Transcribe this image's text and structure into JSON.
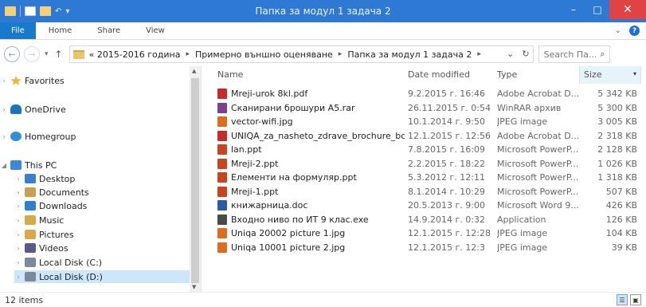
{
  "window": {
    "title": "Папка за модул 1 задача 2",
    "minimize": "–",
    "maximize": "□",
    "close": "✕"
  },
  "ribbon": {
    "tabs": [
      "File",
      "Home",
      "Share",
      "View"
    ],
    "expand_icon": "chevron-down-icon",
    "help_label": "?"
  },
  "address": {
    "breadcrumbs": [
      "« 2015-2016 година",
      "Примерно външно оценяване",
      "Папка за модул 1 задача 2"
    ],
    "search_placeholder": "Search Па...",
    "back_icon": "←",
    "forward_icon": "→",
    "up_icon": "↑",
    "refresh_icon": "↻"
  },
  "navigation": {
    "items": [
      {
        "label": "Favorites",
        "icon": "star-icon",
        "color": "#f0b432"
      },
      {
        "label": "OneDrive",
        "icon": "cloud-icon",
        "color": "#1e73be"
      },
      {
        "label": "Homegroup",
        "icon": "homegroup-icon",
        "color": "#2f8fd8"
      },
      {
        "label": "This PC",
        "icon": "computer-icon",
        "color": "#3b8ad8"
      },
      {
        "label": "Desktop",
        "icon": "desktop-icon",
        "color": "#3a80c9"
      },
      {
        "label": "Documents",
        "icon": "documents-icon",
        "color": "#c9a14e"
      },
      {
        "label": "Downloads",
        "icon": "downloads-icon",
        "color": "#2f7fcf"
      },
      {
        "label": "Music",
        "icon": "music-icon",
        "color": "#d6a94b"
      },
      {
        "label": "Pictures",
        "icon": "pictures-icon",
        "color": "#d6a94b"
      },
      {
        "label": "Videos",
        "icon": "videos-icon",
        "color": "#5a5a8a"
      },
      {
        "label": "Local Disk (C:)",
        "icon": "drive-icon",
        "color": "#7a8a9a"
      },
      {
        "label": "Local Disk (D:)",
        "icon": "drive-icon",
        "color": "#7a8a9a"
      }
    ]
  },
  "file_list": {
    "columns": [
      "Name",
      "Date modified",
      "Type",
      "Size"
    ],
    "rows": [
      {
        "name": "Mreji-urok 8kl.pdf",
        "date": "9.2.2015 г. 16:46",
        "type": "Adobe Acrobat D...",
        "size": "5 342 KB",
        "icon": "pdf-icon",
        "color": "#c92b2b"
      },
      {
        "name": "Сканирани брошури А5.rar",
        "date": "26.11.2015 г. 0:54",
        "type": "WinRAR архив",
        "size": "5 300 KB",
        "icon": "rar-icon",
        "color": "#7a3f8f"
      },
      {
        "name": "vector-wifi.jpg",
        "date": "10.1.2014 г. 9:50",
        "type": "JPEG image",
        "size": "3 005 KB",
        "icon": "image-icon",
        "color": "#e06a1e"
      },
      {
        "name": "UNIQA_za_nasheto_zdrave_brochure_bc...",
        "date": "12.1.2015 г. 12:56",
        "type": "Adobe Acrobat D...",
        "size": "2 318 KB",
        "icon": "pdf-icon",
        "color": "#c92b2b"
      },
      {
        "name": "lan.ppt",
        "date": "7.8.2015 г. 16:09",
        "type": "Microsoft PowerP...",
        "size": "2 128 KB",
        "icon": "ppt-icon",
        "color": "#c8451f"
      },
      {
        "name": "Mreji-2.ppt",
        "date": "2.2.2015 г. 18:22",
        "type": "Microsoft PowerP...",
        "size": "1 026 KB",
        "icon": "ppt-icon",
        "color": "#c8451f"
      },
      {
        "name": "Елементи на формуляр.ppt",
        "date": "5.3.2012 г. 12:11",
        "type": "Microsoft PowerP...",
        "size": "1 318 KB",
        "icon": "ppt-icon",
        "color": "#c8451f"
      },
      {
        "name": "Mreji-1.ppt",
        "date": "8.1.2014 г. 10:29",
        "type": "Microsoft PowerP...",
        "size": "507 KB",
        "icon": "ppt-icon",
        "color": "#c8451f"
      },
      {
        "name": "книжарница.doc",
        "date": "20.5.2013 г. 9:00",
        "type": "Microsoft Word 9...",
        "size": "426 KB",
        "icon": "word-icon",
        "color": "#2a5aa8"
      },
      {
        "name": "Входно ниво по ИТ 9 клас.exe",
        "date": "14.9.2014 г. 0:32",
        "type": "Application",
        "size": "126 KB",
        "icon": "application-icon",
        "color": "#4a4a4a"
      },
      {
        "name": "Uniqa 20002 picture 1.jpg",
        "date": "12.1.2015 г. 12:28",
        "type": "JPEG image",
        "size": "104 KB",
        "icon": "image-icon",
        "color": "#e06a1e"
      },
      {
        "name": "Uniqa 10001 picture 2.jpg",
        "date": "12.1.2015 г. 12:3",
        "type": "JPEG image",
        "size": "39 KB",
        "icon": "image-icon",
        "color": "#e06a1e"
      }
    ]
  },
  "status": {
    "item_count": "12 items"
  }
}
